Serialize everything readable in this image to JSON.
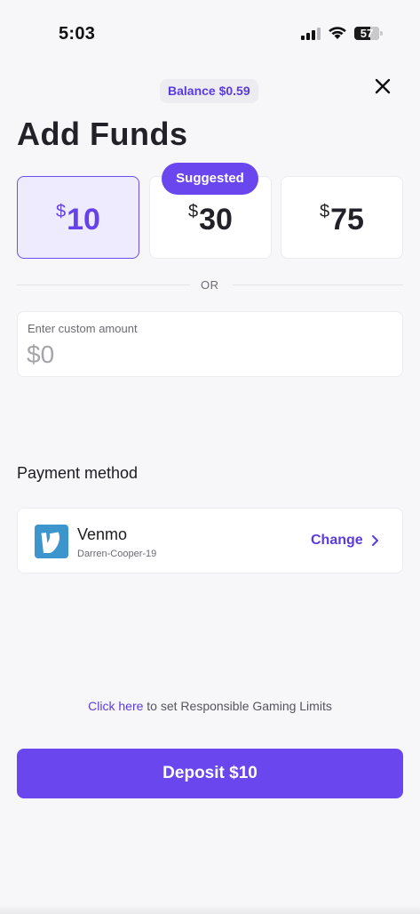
{
  "status_bar": {
    "time": "5:03",
    "battery": "57"
  },
  "header": {
    "balance": "Balance $0.59",
    "title": "Add Funds"
  },
  "amounts": {
    "currency_symbol": "$",
    "options": [
      {
        "value": "10",
        "selected": true
      },
      {
        "value": "30",
        "selected": false
      },
      {
        "value": "75",
        "selected": false
      }
    ],
    "suggested_label": "Suggested"
  },
  "divider_text": "OR",
  "custom_amount": {
    "label": "Enter custom amount",
    "placeholder": "$0",
    "value": ""
  },
  "payment": {
    "heading": "Payment method",
    "provider": "Venmo",
    "username": "Darren-Cooper-19",
    "change_label": "Change"
  },
  "responsible_gaming": {
    "link_text": "Click here",
    "rest_text": " to set Responsible Gaming Limits"
  },
  "deposit_button": "Deposit $10",
  "colors": {
    "accent": "#6a46ef",
    "accent_text": "#5a3be0",
    "venmo": "#3d95ce",
    "background": "#f7f7f9"
  }
}
